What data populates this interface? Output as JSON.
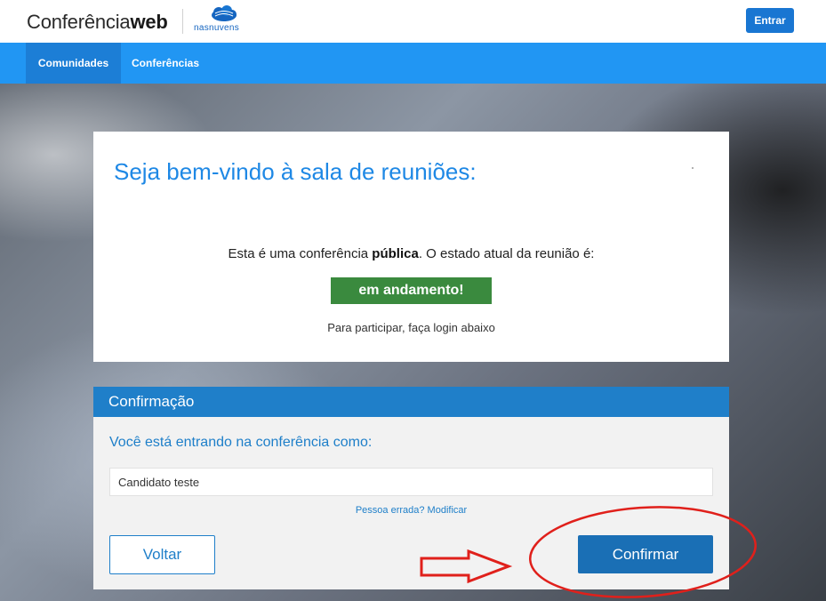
{
  "header": {
    "logo_regular": "Conferência",
    "logo_bold": "web",
    "partner_name": "nasnuvens",
    "login_button": "Entrar"
  },
  "nav": {
    "items": [
      {
        "label": "Comunidades"
      },
      {
        "label": "Conferências"
      }
    ]
  },
  "welcome": {
    "title": "Seja bem-vindo à sala de reuniões:",
    "public_prefix": "Esta é uma conferência ",
    "public_bold": "pública",
    "public_suffix": ". O estado atual da reunião é:",
    "status": "em andamento!",
    "login_hint": "Para participar, faça login abaixo"
  },
  "confirmation": {
    "header": "Confirmação",
    "entering_as": "Você está entrando na conferência como:",
    "name_value": "Candidato teste",
    "wrong_person_link": "Pessoa errada? Modificar",
    "back_button": "Voltar",
    "confirm_button": "Confirmar"
  },
  "colors": {
    "primary": "#2196f3",
    "header_blue": "#1f7fc9",
    "status_green": "#3a8a3e",
    "annotation_red": "#e0201b"
  },
  "icons": {
    "partner_logo": "cloud-icon",
    "annotation_arrow": "arrow-right-icon",
    "annotation_circle": "circle-highlight"
  }
}
